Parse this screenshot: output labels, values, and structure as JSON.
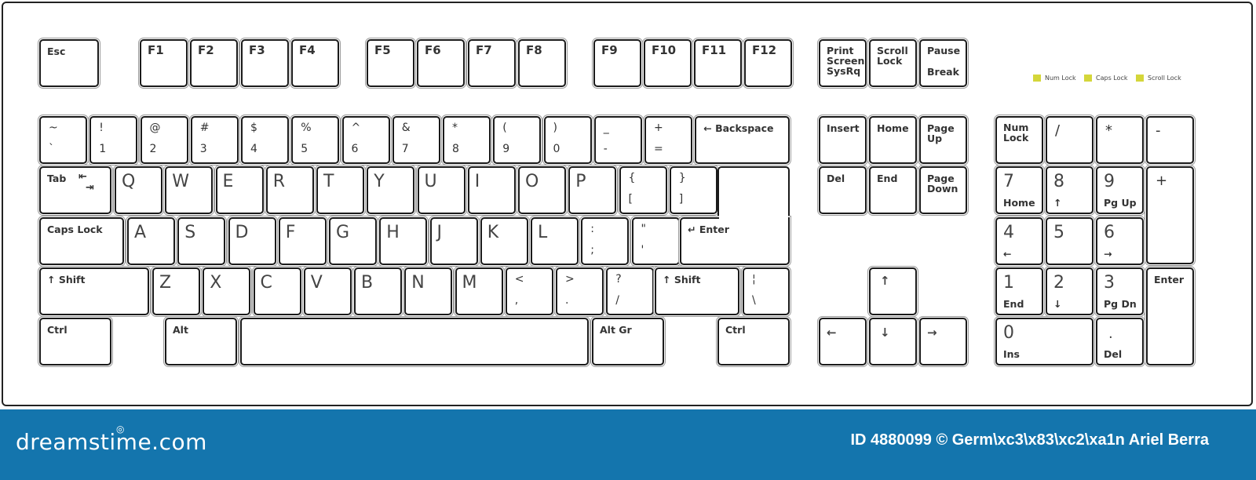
{
  "keyboard": {
    "function_row": {
      "esc": "Esc",
      "f_keys": [
        "F1",
        "F2",
        "F3",
        "F4",
        "F5",
        "F6",
        "F7",
        "F8",
        "F9",
        "F10",
        "F11",
        "F12"
      ],
      "print_screen": "Print\nScreen\nSysRq",
      "scroll_lock": "Scroll\nLock",
      "pause_top": "Pause",
      "pause_bottom": "Break"
    },
    "indicators": [
      {
        "label": "Num Lock",
        "color": "#d4d63a"
      },
      {
        "label": "Caps Lock",
        "color": "#d4d63a"
      },
      {
        "label": "Scroll Lock",
        "color": "#d4d63a"
      }
    ],
    "number_row": [
      {
        "top": "~",
        "bottom": "`"
      },
      {
        "top": "!",
        "bottom": "1"
      },
      {
        "top": "@",
        "bottom": "2"
      },
      {
        "top": "#",
        "bottom": "3"
      },
      {
        "top": "$",
        "bottom": "4"
      },
      {
        "top": "%",
        "bottom": "5"
      },
      {
        "top": "^",
        "bottom": "6"
      },
      {
        "top": "&",
        "bottom": "7"
      },
      {
        "top": "*",
        "bottom": "8"
      },
      {
        "top": "(",
        "bottom": "9"
      },
      {
        "top": ")",
        "bottom": "0"
      },
      {
        "top": "_",
        "bottom": "-"
      },
      {
        "top": "+",
        "bottom": "="
      }
    ],
    "backspace": "← Backspace",
    "tab": "Tab",
    "tab_icon": "⇤\n  ⇥",
    "qwerty_row": [
      "Q",
      "W",
      "E",
      "R",
      "T",
      "Y",
      "U",
      "I",
      "O",
      "P"
    ],
    "brackets": [
      {
        "top": "{",
        "bottom": "["
      },
      {
        "top": "}",
        "bottom": "]"
      }
    ],
    "caps_lock": "Caps Lock",
    "home_row": [
      "A",
      "S",
      "D",
      "F",
      "G",
      "H",
      "J",
      "K",
      "L"
    ],
    "home_symbols": [
      {
        "top": ":",
        "bottom": ";"
      },
      {
        "top": "\"",
        "bottom": "'"
      }
    ],
    "enter": "↵ Enter",
    "shift_left": "↑ Shift",
    "bottom_letters": [
      "Z",
      "X",
      "C",
      "V",
      "B",
      "N",
      "M"
    ],
    "bottom_symbols": [
      {
        "top": "<",
        "bottom": ","
      },
      {
        "top": ">",
        "bottom": "."
      },
      {
        "top": "?",
        "bottom": "/"
      }
    ],
    "shift_right": "↑ Shift",
    "pipe": {
      "top": "¦",
      "bottom": "\\"
    },
    "ctrl_left": "Ctrl",
    "alt": "Alt",
    "space": "",
    "alt_gr": "Alt Gr",
    "ctrl_right": "Ctrl",
    "nav_cluster": {
      "insert": "Insert",
      "home": "Home",
      "page_up": "Page\nUp",
      "del": "Del",
      "end": "End",
      "page_down": "Page\nDown"
    },
    "arrows": {
      "up": "↑",
      "left": "←",
      "down": "↓",
      "right": "→"
    },
    "numpad": {
      "num_lock": "Num\nLock",
      "divide": "/",
      "multiply": "*",
      "minus": "-",
      "plus": "+",
      "enter": "Enter",
      "keys": [
        {
          "num": "7",
          "sub": "Home"
        },
        {
          "num": "8",
          "sub": "↑"
        },
        {
          "num": "9",
          "sub": "Pg Up"
        },
        {
          "num": "4",
          "sub": "←"
        },
        {
          "num": "5",
          "sub": ""
        },
        {
          "num": "6",
          "sub": "→"
        },
        {
          "num": "1",
          "sub": "End"
        },
        {
          "num": "2",
          "sub": "↓"
        },
        {
          "num": "3",
          "sub": "Pg Dn"
        },
        {
          "num": "0",
          "sub": "Ins"
        },
        {
          "num": ".",
          "sub": "Del"
        }
      ]
    }
  },
  "footer": {
    "brand": "dreamstime.com",
    "credit": "ID 4880099 © Germ\\xc3\\x83\\xc2\\xa1n Ariel Berra",
    "background": "#1475ad"
  }
}
